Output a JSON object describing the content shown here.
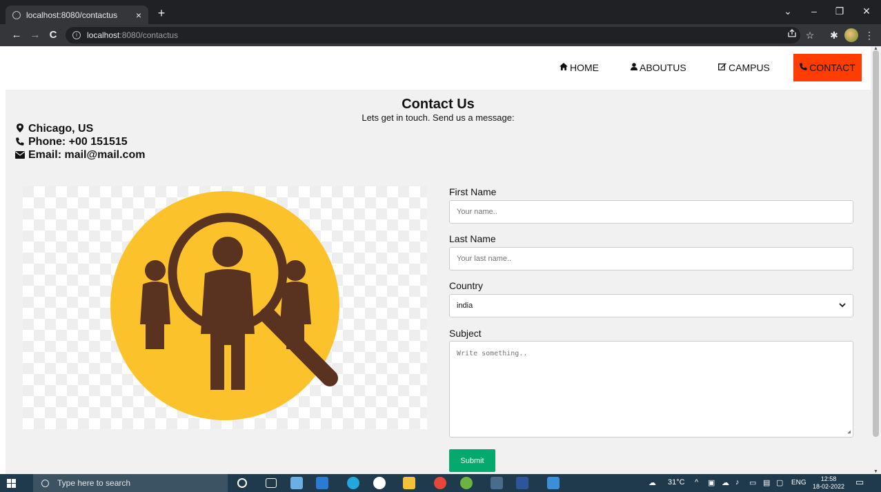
{
  "browser": {
    "tab_title": "localhost:8080/contactus",
    "tab_close": "×",
    "new_tab": "+",
    "url_host": "localhost",
    "url_path": ":8080/contactus",
    "back": "←",
    "forward": "→",
    "reload": "C",
    "window_controls": [
      "⌄",
      "–",
      "❐",
      "✕"
    ],
    "toolbar_icons": [
      "share-icon",
      "star-icon",
      "extensions-icon",
      "profile-icon",
      "menu-icon"
    ]
  },
  "nav": {
    "home": "HOME",
    "about": "ABOUTUS",
    "campus": "CAMPUS",
    "contact": "CONTACT",
    "active_color": "#ff3d00"
  },
  "contact": {
    "title": "Contact Us",
    "subtitle": "Lets get in touch. Send us a message:",
    "location": "Chicago, US",
    "phone": "Phone: +00 151515",
    "email": "Email: mail@mail.com"
  },
  "form": {
    "first_name_label": "First Name",
    "first_name_placeholder": "Your name..",
    "last_name_label": "Last Name",
    "last_name_placeholder": "Your last name..",
    "country_label": "Country",
    "country_value": "india",
    "subject_label": "Subject",
    "subject_placeholder": "Write something..",
    "submit_label": "Submit",
    "submit_color": "#04aa6d"
  },
  "illustration": {
    "circle_color": "#fcc22c",
    "figure_color": "#5a3220"
  },
  "taskbar": {
    "search_placeholder": "Type here to search",
    "weather": "31°C",
    "language": "ENG",
    "time": "12:58",
    "date": "18-02-2022"
  }
}
